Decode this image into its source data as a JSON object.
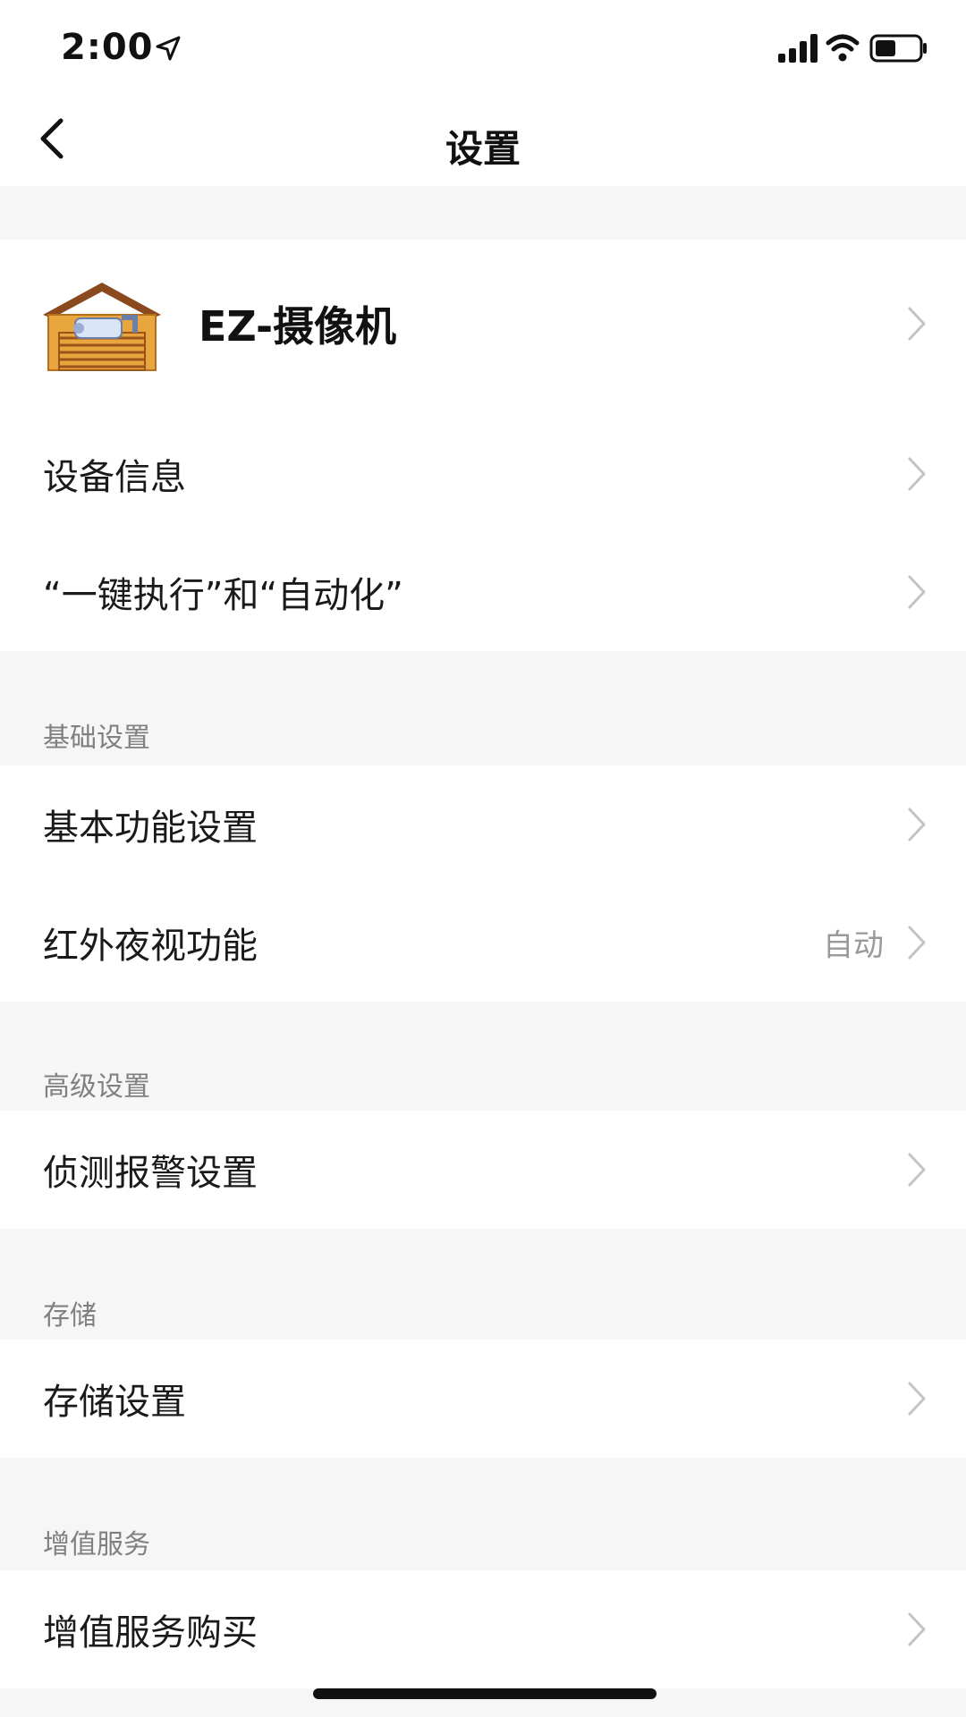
{
  "status_bar": {
    "time": "2:00"
  },
  "nav": {
    "title": "设置"
  },
  "device": {
    "name": "EZ-摄像机"
  },
  "top_items": [
    {
      "label": "设备信息"
    },
    {
      "label": "“一键执行”和“自动化”"
    }
  ],
  "sections": [
    {
      "title": "基础设置",
      "items": [
        {
          "label": "基本功能设置",
          "value": ""
        },
        {
          "label": "红外夜视功能",
          "value": "自动"
        }
      ]
    },
    {
      "title": "高级设置",
      "items": [
        {
          "label": "侦测报警设置",
          "value": ""
        }
      ]
    },
    {
      "title": "存储",
      "items": [
        {
          "label": "存储设置",
          "value": ""
        }
      ]
    },
    {
      "title": "增值服务",
      "items": [
        {
          "label": "增值服务购买",
          "value": ""
        }
      ]
    }
  ],
  "icons": {
    "back": "chevron-left-icon",
    "row_arrow": "chevron-right-icon",
    "device": "camera-garage-icon",
    "location": "location-arrow-icon",
    "signal": "cellular-signal-icon",
    "wifi": "wifi-icon",
    "battery": "battery-icon"
  },
  "colors": {
    "background": "#f6f6f6",
    "card": "#ffffff",
    "primary_text": "#1a1a1a",
    "secondary_text": "#808080",
    "chevron": "#c4c4c4",
    "icon_roof": "#8a4a1e",
    "icon_wall": "#e9a53e"
  }
}
